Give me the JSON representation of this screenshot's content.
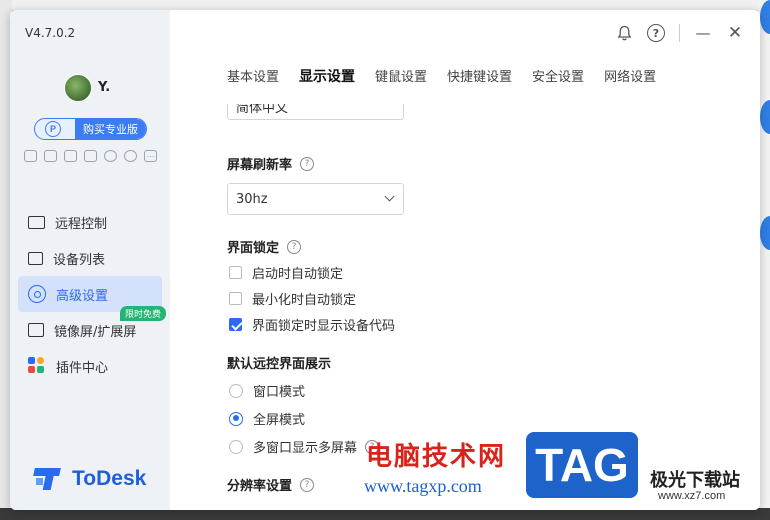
{
  "app": {
    "version": "V4.7.0.2",
    "username": "Y.",
    "pro_button": {
      "icon_letter": "P",
      "label": "购买专业版"
    },
    "logo_text": "ToDesk"
  },
  "sidebar": {
    "items": [
      {
        "label": "远程控制",
        "icon": "monitor-icon"
      },
      {
        "label": "设备列表",
        "icon": "devices-icon"
      },
      {
        "label": "高级设置",
        "icon": "settings-hex-icon",
        "active": true
      },
      {
        "label": "镜像屏/扩展屏",
        "icon": "mirror-screen-icon",
        "badge": "限时免费"
      },
      {
        "label": "插件中心",
        "icon": "plugin-icon"
      }
    ]
  },
  "titlebar": {
    "bell_icon": "bell-icon",
    "help_glyph": "?",
    "minimize_glyph": "—",
    "close_glyph": "✕"
  },
  "tabs": [
    {
      "label": "基本设置"
    },
    {
      "label": "显示设置",
      "active": true
    },
    {
      "label": "键鼠设置"
    },
    {
      "label": "快捷键设置"
    },
    {
      "label": "安全设置"
    },
    {
      "label": "网络设置"
    }
  ],
  "settings": {
    "partial_select_value": "简体中文",
    "refresh_rate": {
      "title": "屏幕刷新率",
      "help": "?",
      "value": "30hz"
    },
    "lock": {
      "title": "界面锁定",
      "help": "?",
      "options": [
        {
          "label": "启动时自动锁定",
          "checked": false
        },
        {
          "label": "最小化时自动锁定",
          "checked": false
        },
        {
          "label": "界面锁定时显示设备代码",
          "checked": true
        }
      ]
    },
    "default_view": {
      "title": "默认远控界面展示",
      "options": [
        {
          "label": "窗口模式",
          "checked": false
        },
        {
          "label": "全屏模式",
          "checked": true
        },
        {
          "label": "多窗口显示多屏幕",
          "checked": false,
          "help": "?"
        }
      ]
    },
    "resolution": {
      "title": "分辨率设置",
      "help": "?"
    }
  },
  "watermark": {
    "cn_text": "电脑技术网",
    "url": "www.tagxp.com",
    "tag": "TAG",
    "site": "极光下载站",
    "site_url": "www.xz7.com"
  },
  "colors": {
    "accent": "#2a6af0",
    "sidebar_bg": "#eef1f6",
    "active_nav_bg": "#d3e1fb",
    "badge_green": "#22b573"
  }
}
